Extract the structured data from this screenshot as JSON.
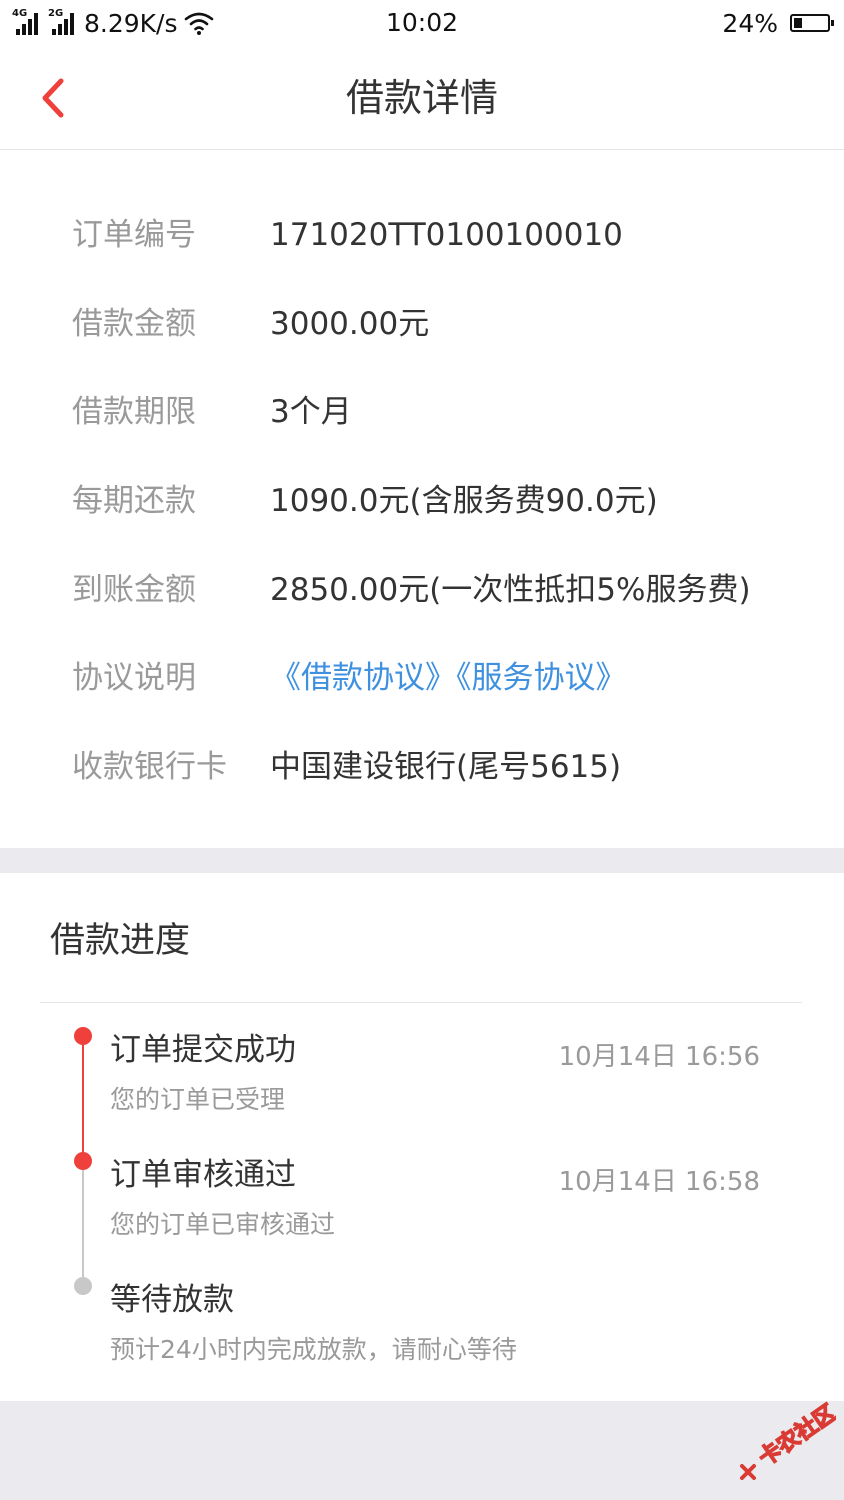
{
  "status_bar": {
    "net_label_1": "4G",
    "net_label_2": "2G",
    "speed": "8.29K/s",
    "time": "10:02",
    "battery_percent": "24%",
    "battery_level": 0.24
  },
  "nav": {
    "title": "借款详情",
    "back_icon": "chevron-left-icon"
  },
  "details": {
    "rows": [
      {
        "label": "订单编号",
        "value": "171020TT0100100010"
      },
      {
        "label": "借款金额",
        "value": "3000.00元"
      },
      {
        "label": "借款期限",
        "value": "3个月"
      },
      {
        "label": "每期还款",
        "value": "1090.0元(含服务费90.0元)"
      },
      {
        "label": "到账金额",
        "value": "2850.00元(一次性抵扣5%服务费)"
      },
      {
        "label": "协议说明",
        "links": [
          "《借款协议》",
          "《服务协议》"
        ]
      },
      {
        "label": "收款银行卡",
        "value": "中国建设银行(尾号5615)"
      }
    ]
  },
  "progress": {
    "title": "借款进度",
    "steps": [
      {
        "title": "订单提交成功",
        "desc": "您的订单已受理",
        "time": "10月14日 16:56",
        "status": "done"
      },
      {
        "title": "订单审核通过",
        "desc": "您的订单已审核通过",
        "time": "10月14日 16:58",
        "status": "done"
      },
      {
        "title": "等待放款",
        "desc": "预计24小时内完成放款，请耐心等待",
        "status": "pending"
      }
    ]
  },
  "watermark": {
    "text": "卡农社区"
  },
  "colors": {
    "accent": "#f0403c",
    "link": "#3f91e0",
    "pending": "#c8c8c8",
    "label": "#9a9a9a",
    "text": "#333333"
  }
}
